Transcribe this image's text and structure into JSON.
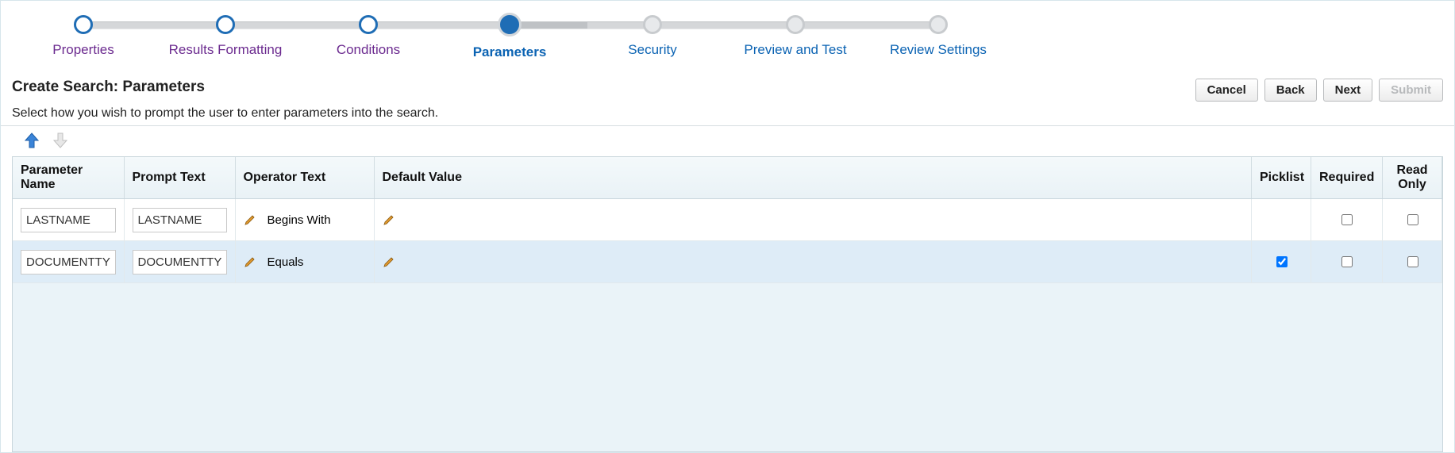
{
  "stepper": {
    "steps": [
      {
        "label": "Properties",
        "state": "done"
      },
      {
        "label": "Results Formatting",
        "state": "done"
      },
      {
        "label": "Conditions",
        "state": "done"
      },
      {
        "label": "Parameters",
        "state": "current"
      },
      {
        "label": "Security",
        "state": "future"
      },
      {
        "label": "Preview and Test",
        "state": "future"
      },
      {
        "label": "Review Settings",
        "state": "future"
      }
    ]
  },
  "header": {
    "title": "Create Search: Parameters",
    "buttons": {
      "cancel": "Cancel",
      "back": "Back",
      "next": "Next",
      "submit": "Submit"
    }
  },
  "subtitle": "Select how you wish to prompt the user to enter parameters into the search.",
  "arrows": {
    "up": "move-up-icon",
    "down": "move-down-icon"
  },
  "columns": {
    "param_name": "Parameter Name",
    "prompt_text": "Prompt Text",
    "operator_text": "Operator Text",
    "default_value": "Default Value",
    "picklist": "Picklist",
    "required": "Required",
    "read_only": "Read Only"
  },
  "rows": [
    {
      "param_name": "LASTNAME",
      "prompt_text": "LASTNAME",
      "operator_text": "Begins With",
      "default_value": "",
      "picklist": false,
      "picklist_visible": false,
      "required": false,
      "read_only": false,
      "selected": false
    },
    {
      "param_name": "DOCUMENTTYPE",
      "prompt_text": "DOCUMENTTYPE",
      "operator_text": "Equals",
      "default_value": "",
      "picklist": true,
      "picklist_visible": true,
      "required": false,
      "read_only": false,
      "selected": true
    }
  ]
}
